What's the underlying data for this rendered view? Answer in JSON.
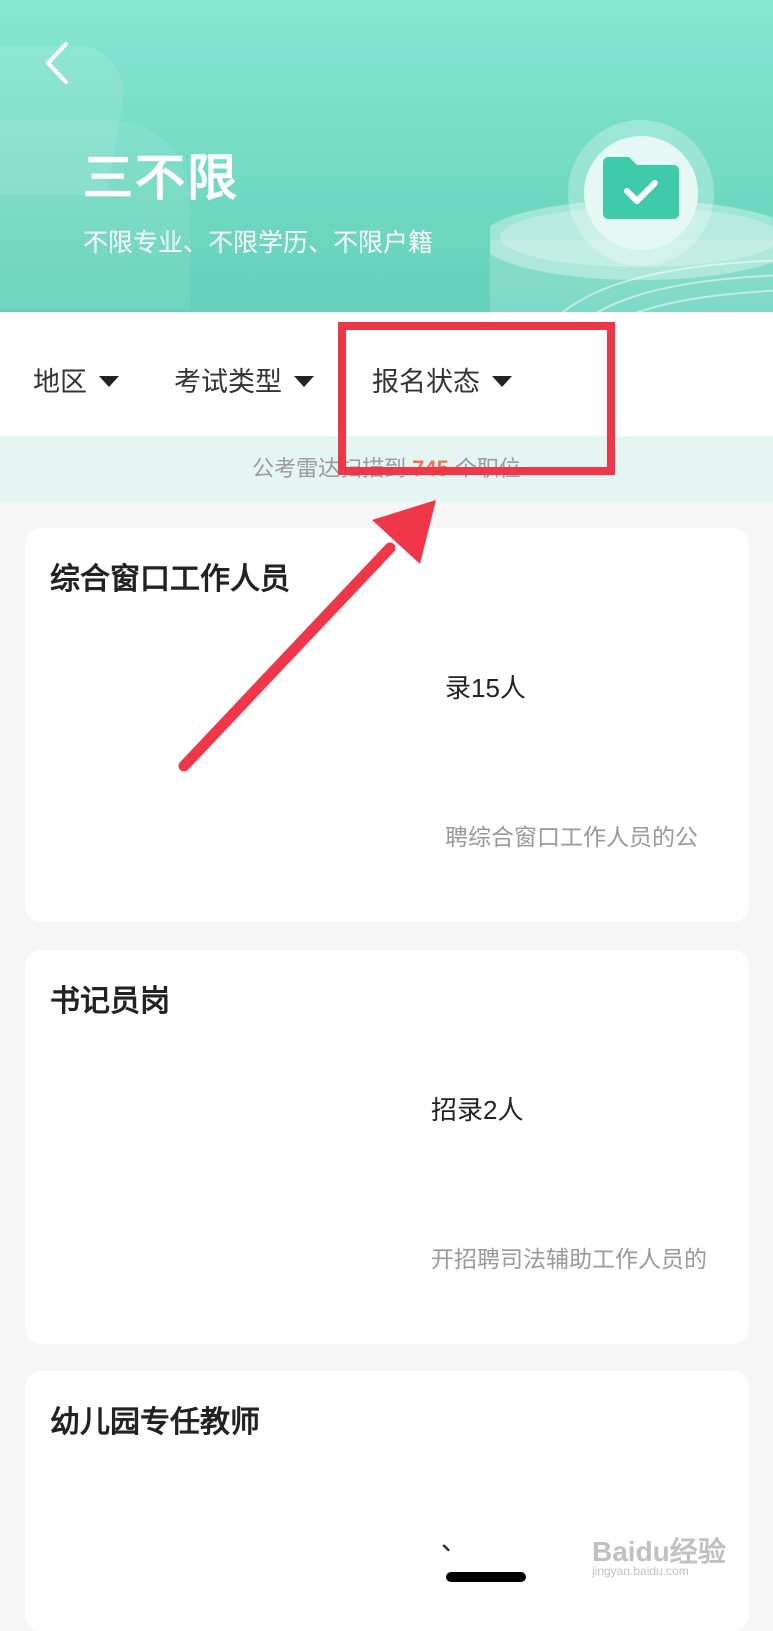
{
  "header": {
    "title": "三不限",
    "subtitle": "不限专业、不限学历、不限户籍",
    "back_icon": "chevron-left-icon",
    "emblem_icon": "folder-check-icon"
  },
  "filters": [
    {
      "label": "地区"
    },
    {
      "label": "考试类型"
    },
    {
      "label": "报名状态"
    }
  ],
  "banner": {
    "prefix": "公考雷达扫描到",
    "count": "745",
    "suffix": "个职位"
  },
  "jobs": [
    {
      "title": "综合窗口工作人员",
      "recruit": "录15人",
      "desc": "聘综合窗口工作人员的公"
    },
    {
      "title": "书记员岗",
      "recruit": "招录2人",
      "desc": "开招聘司法辅助工作人员的"
    },
    {
      "title": "幼儿园专任教师",
      "recruit": "、",
      "desc": ""
    }
  ],
  "watermark": {
    "text": "Baidu经验",
    "sub": "jingyan.baidu.com"
  },
  "colors": {
    "header": "#6ed7c0",
    "accent_count": "#f07353",
    "annotation": "#ef3749"
  }
}
